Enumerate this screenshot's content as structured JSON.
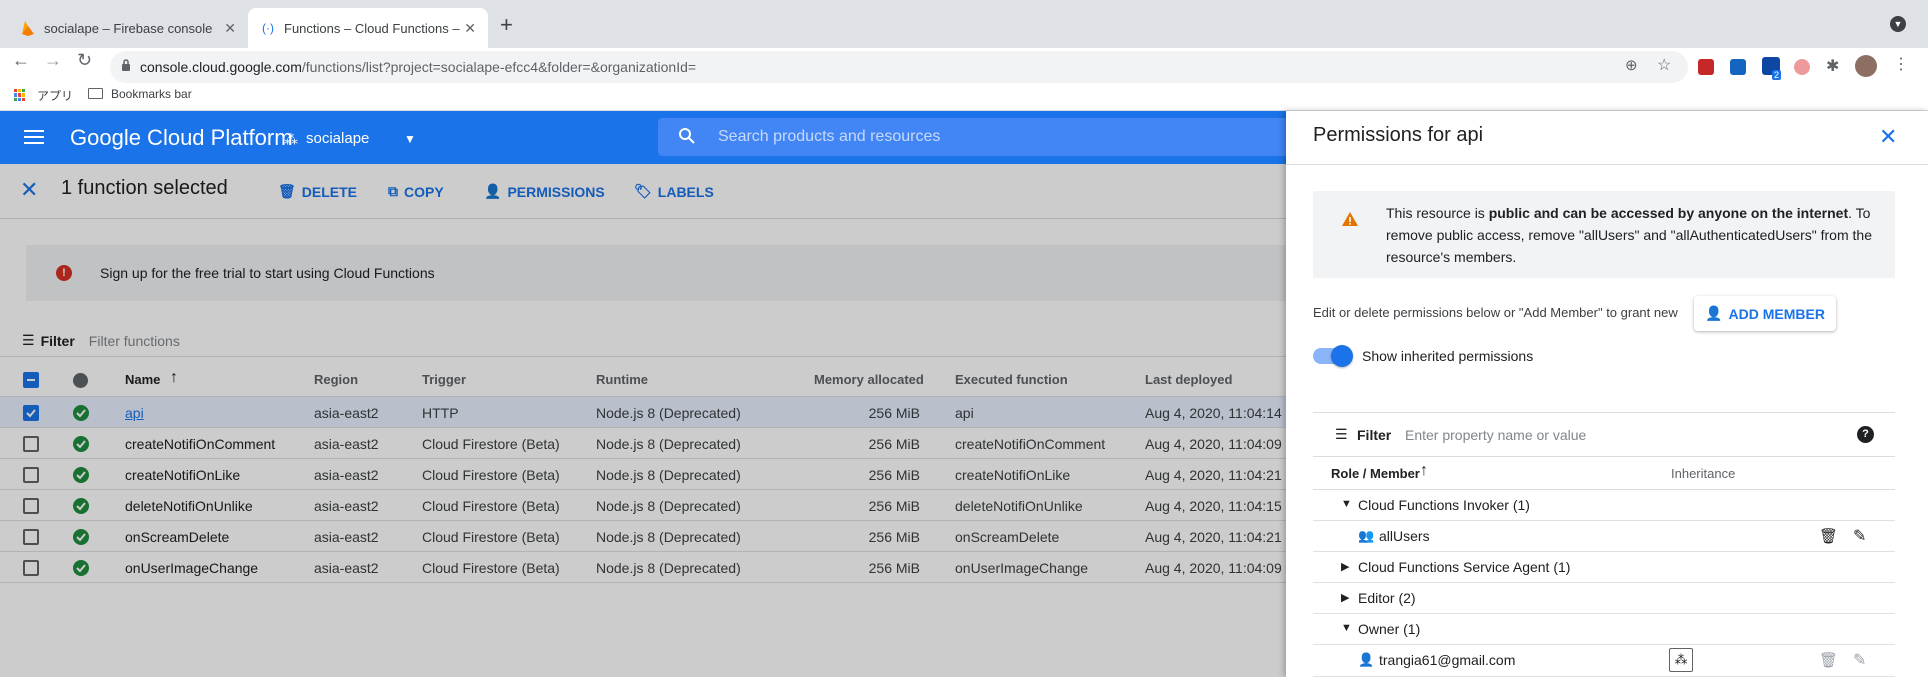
{
  "browser": {
    "tabs": [
      {
        "title": "socialape – Firebase console"
      },
      {
        "title": "Functions – Cloud Functions –"
      }
    ],
    "url_host": "console.cloud.google.com",
    "url_path": "/functions/list?project=socialape-efcc4&folder=&organizationId=",
    "bookmarks": {
      "apps": "アプリ",
      "bar": "Bookmarks bar"
    },
    "extension_badge": "2"
  },
  "gcp": {
    "title": "Google Cloud Platform",
    "project": "socialape",
    "search_placeholder": "Search products and resources"
  },
  "actionbar": {
    "selected_text": "1 function selected",
    "delete": "DELETE",
    "copy": "COPY",
    "permissions": "PERMISSIONS",
    "labels": "LABELS"
  },
  "banner": {
    "text": "Sign up for the free trial to start using Cloud Functions"
  },
  "filter": {
    "label": "Filter",
    "placeholder": "Filter functions"
  },
  "table": {
    "headers": {
      "name": "Name",
      "region": "Region",
      "trigger": "Trigger",
      "runtime": "Runtime",
      "memory": "Memory allocated",
      "executed": "Executed function",
      "deployed": "Last deployed"
    },
    "rows": [
      {
        "name": "api",
        "region": "asia-east2",
        "trigger": "HTTP",
        "runtime": "Node.js 8 (Deprecated)",
        "memory": "256 MiB",
        "executed": "api",
        "deployed": "Aug 4, 2020, 11:04:14",
        "selected": true
      },
      {
        "name": "createNotifiOnComment",
        "region": "asia-east2",
        "trigger": "Cloud Firestore (Beta)",
        "runtime": "Node.js 8 (Deprecated)",
        "memory": "256 MiB",
        "executed": "createNotifiOnComment",
        "deployed": "Aug 4, 2020, 11:04:09",
        "selected": false
      },
      {
        "name": "createNotifiOnLike",
        "region": "asia-east2",
        "trigger": "Cloud Firestore (Beta)",
        "runtime": "Node.js 8 (Deprecated)",
        "memory": "256 MiB",
        "executed": "createNotifiOnLike",
        "deployed": "Aug 4, 2020, 11:04:21",
        "selected": false
      },
      {
        "name": "deleteNotifiOnUnlike",
        "region": "asia-east2",
        "trigger": "Cloud Firestore (Beta)",
        "runtime": "Node.js 8 (Deprecated)",
        "memory": "256 MiB",
        "executed": "deleteNotifiOnUnlike",
        "deployed": "Aug 4, 2020, 11:04:15",
        "selected": false
      },
      {
        "name": "onScreamDelete",
        "region": "asia-east2",
        "trigger": "Cloud Firestore (Beta)",
        "runtime": "Node.js 8 (Deprecated)",
        "memory": "256 MiB",
        "executed": "onScreamDelete",
        "deployed": "Aug 4, 2020, 11:04:21",
        "selected": false
      },
      {
        "name": "onUserImageChange",
        "region": "asia-east2",
        "trigger": "Cloud Firestore (Beta)",
        "runtime": "Node.js 8 (Deprecated)",
        "memory": "256 MiB",
        "executed": "onUserImageChange",
        "deployed": "Aug 4, 2020, 11:04:09",
        "selected": false
      }
    ]
  },
  "panel": {
    "title": "Permissions for api",
    "warning_pre": "This resource is ",
    "warning_bold": "public and can be accessed by anyone on the internet",
    "warning_post": ". To remove public access, remove \"allUsers\" and \"allAuthenticatedUsers\" from the resource's members.",
    "hint": "Edit or delete permissions below or \"Add Member\" to grant new",
    "add_member": "ADD MEMBER",
    "toggle_label": "Show inherited permissions",
    "filter_label": "Filter",
    "filter_placeholder": "Enter property name or value",
    "col_role": "Role / Member",
    "col_inheritance": "Inheritance",
    "roles": [
      {
        "label": "Cloud Functions Invoker (1)",
        "expanded": true
      },
      {
        "member": "allUsers"
      },
      {
        "label": "Cloud Functions Service Agent (1)",
        "expanded": false
      },
      {
        "label": "Editor (2)",
        "expanded": false
      },
      {
        "label": "Owner (1)",
        "expanded": true
      },
      {
        "member": "trangia61@gmail.com"
      }
    ]
  },
  "colors": {
    "gcp_blue": "#1a73e8",
    "success": "#1e8e3e",
    "error": "#d93025",
    "warning": "#e37400"
  }
}
